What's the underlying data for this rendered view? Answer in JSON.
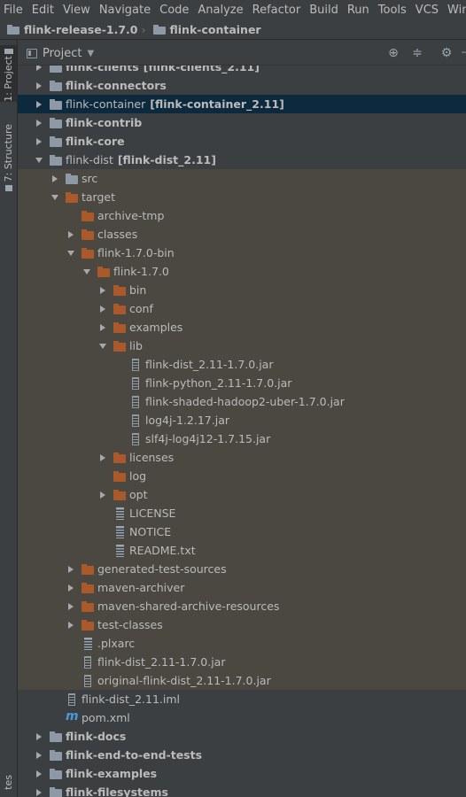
{
  "menu": [
    "File",
    "Edit",
    "View",
    "Navigate",
    "Code",
    "Analyze",
    "Refactor",
    "Build",
    "Run",
    "Tools",
    "VCS",
    "Window"
  ],
  "breadcrumb": [
    "flink-release-1.7.0",
    "flink-container"
  ],
  "sidebar": {
    "project_tab": "1: Project",
    "structure_tab": "7: Structure",
    "favorites_tab": "tes"
  },
  "panel": {
    "title": "Project",
    "icons": [
      "crosshair-icon",
      "collapse-all-icon",
      "gear-icon",
      "hide-icon"
    ]
  },
  "tree": [
    {
      "label": "flink-clients",
      "module": "flink-clients_2.11",
      "depth": 0,
      "arrow": "right",
      "icon": "module",
      "bold": true,
      "state": ""
    },
    {
      "label": "flink-connectors",
      "module": "",
      "depth": 0,
      "arrow": "right",
      "icon": "module",
      "bold": true,
      "state": ""
    },
    {
      "label": "flink-container",
      "module": "flink-container_2.11",
      "depth": 0,
      "arrow": "right",
      "icon": "module",
      "bold": false,
      "state": "sel"
    },
    {
      "label": "flink-contrib",
      "module": "",
      "depth": 0,
      "arrow": "right",
      "icon": "module",
      "bold": true,
      "state": ""
    },
    {
      "label": "flink-core",
      "module": "",
      "depth": 0,
      "arrow": "right",
      "icon": "module",
      "bold": true,
      "state": ""
    },
    {
      "label": "flink-dist",
      "module": "flink-dist_2.11",
      "depth": 0,
      "arrow": "down",
      "icon": "module",
      "bold": false,
      "state": ""
    },
    {
      "label": "src",
      "module": "",
      "depth": 1,
      "arrow": "right",
      "icon": "srcfolder",
      "bold": false,
      "state": "hl"
    },
    {
      "label": "target",
      "module": "",
      "depth": 1,
      "arrow": "down",
      "icon": "folder",
      "bold": false,
      "state": "hl"
    },
    {
      "label": "archive-tmp",
      "module": "",
      "depth": 2,
      "arrow": "none",
      "icon": "folder",
      "bold": false,
      "state": "hl"
    },
    {
      "label": "classes",
      "module": "",
      "depth": 2,
      "arrow": "right",
      "icon": "folder",
      "bold": false,
      "state": "hl"
    },
    {
      "label": "flink-1.7.0-bin",
      "module": "",
      "depth": 2,
      "arrow": "down",
      "icon": "folder",
      "bold": false,
      "state": "hl"
    },
    {
      "label": "flink-1.7.0",
      "module": "",
      "depth": 3,
      "arrow": "down",
      "icon": "folder",
      "bold": false,
      "state": "hl"
    },
    {
      "label": "bin",
      "module": "",
      "depth": 4,
      "arrow": "right",
      "icon": "folder",
      "bold": false,
      "state": "hl"
    },
    {
      "label": "conf",
      "module": "",
      "depth": 4,
      "arrow": "right",
      "icon": "folder",
      "bold": false,
      "state": "hl"
    },
    {
      "label": "examples",
      "module": "",
      "depth": 4,
      "arrow": "right",
      "icon": "folder",
      "bold": false,
      "state": "hl"
    },
    {
      "label": "lib",
      "module": "",
      "depth": 4,
      "arrow": "down",
      "icon": "folder",
      "bold": false,
      "state": "hl"
    },
    {
      "label": "flink-dist_2.11-1.7.0.jar",
      "module": "",
      "depth": 5,
      "arrow": "none",
      "icon": "jar",
      "bold": false,
      "state": "hl"
    },
    {
      "label": "flink-python_2.11-1.7.0.jar",
      "module": "",
      "depth": 5,
      "arrow": "none",
      "icon": "jar",
      "bold": false,
      "state": "hl"
    },
    {
      "label": "flink-shaded-hadoop2-uber-1.7.0.jar",
      "module": "",
      "depth": 5,
      "arrow": "none",
      "icon": "jar",
      "bold": false,
      "state": "hl"
    },
    {
      "label": "log4j-1.2.17.jar",
      "module": "",
      "depth": 5,
      "arrow": "none",
      "icon": "jar",
      "bold": false,
      "state": "hl"
    },
    {
      "label": "slf4j-log4j12-1.7.15.jar",
      "module": "",
      "depth": 5,
      "arrow": "none",
      "icon": "jar",
      "bold": false,
      "state": "hl"
    },
    {
      "label": "licenses",
      "module": "",
      "depth": 4,
      "arrow": "right",
      "icon": "folder",
      "bold": false,
      "state": "hl"
    },
    {
      "label": "log",
      "module": "",
      "depth": 4,
      "arrow": "none",
      "icon": "folder",
      "bold": false,
      "state": "hl"
    },
    {
      "label": "opt",
      "module": "",
      "depth": 4,
      "arrow": "right",
      "icon": "folder",
      "bold": false,
      "state": "hl"
    },
    {
      "label": "LICENSE",
      "module": "",
      "depth": 4,
      "arrow": "none",
      "icon": "text",
      "bold": false,
      "state": "hl"
    },
    {
      "label": "NOTICE",
      "module": "",
      "depth": 4,
      "arrow": "none",
      "icon": "text",
      "bold": false,
      "state": "hl"
    },
    {
      "label": "README.txt",
      "module": "",
      "depth": 4,
      "arrow": "none",
      "icon": "text",
      "bold": false,
      "state": "hl"
    },
    {
      "label": "generated-test-sources",
      "module": "",
      "depth": 2,
      "arrow": "right",
      "icon": "folder",
      "bold": false,
      "state": "hl"
    },
    {
      "label": "maven-archiver",
      "module": "",
      "depth": 2,
      "arrow": "right",
      "icon": "folder",
      "bold": false,
      "state": "hl"
    },
    {
      "label": "maven-shared-archive-resources",
      "module": "",
      "depth": 2,
      "arrow": "right",
      "icon": "folder",
      "bold": false,
      "state": "hl"
    },
    {
      "label": "test-classes",
      "module": "",
      "depth": 2,
      "arrow": "right",
      "icon": "folder",
      "bold": false,
      "state": "hl"
    },
    {
      "label": ".plxarc",
      "module": "",
      "depth": 2,
      "arrow": "none",
      "icon": "text",
      "bold": false,
      "state": "hl"
    },
    {
      "label": "flink-dist_2.11-1.7.0.jar",
      "module": "",
      "depth": 2,
      "arrow": "none",
      "icon": "jar",
      "bold": false,
      "state": "hl"
    },
    {
      "label": "original-flink-dist_2.11-1.7.0.jar",
      "module": "",
      "depth": 2,
      "arrow": "none",
      "icon": "jar",
      "bold": false,
      "state": "hl"
    },
    {
      "label": "flink-dist_2.11.iml",
      "module": "",
      "depth": 1,
      "arrow": "none",
      "icon": "jar",
      "bold": false,
      "state": ""
    },
    {
      "label": "pom.xml",
      "module": "",
      "depth": 1,
      "arrow": "none",
      "icon": "maven",
      "bold": false,
      "state": ""
    },
    {
      "label": "flink-docs",
      "module": "",
      "depth": 0,
      "arrow": "right",
      "icon": "module",
      "bold": true,
      "state": ""
    },
    {
      "label": "flink-end-to-end-tests",
      "module": "",
      "depth": 0,
      "arrow": "right",
      "icon": "module",
      "bold": true,
      "state": ""
    },
    {
      "label": "flink-examples",
      "module": "",
      "depth": 0,
      "arrow": "right",
      "icon": "module",
      "bold": true,
      "state": ""
    },
    {
      "label": "flink-filesystems",
      "module": "",
      "depth": 0,
      "arrow": "right",
      "icon": "module",
      "bold": true,
      "state": ""
    }
  ]
}
